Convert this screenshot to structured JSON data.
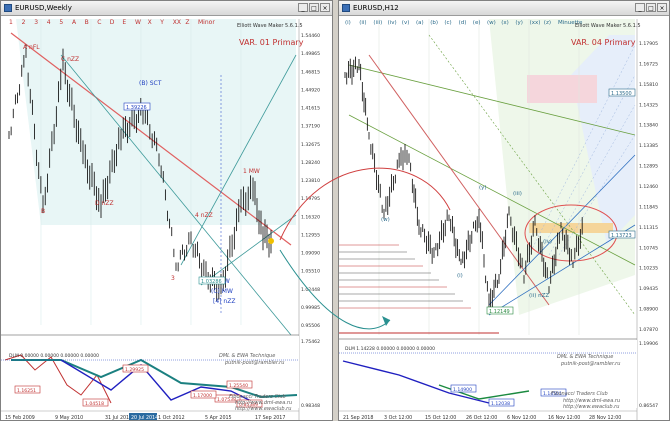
{
  "left_window": {
    "title": "EURUSD,Weekly",
    "indicator_name": "Elliott Wave Maker 5.6.1.5",
    "variant": "VAR. 01 Primary",
    "top_labels": [
      "1",
      "2",
      "3",
      "4",
      "5",
      "A",
      "B",
      "C",
      "D",
      "E",
      "W",
      "X",
      "Y",
      "XX",
      "Z",
      "Minor"
    ],
    "price_scale": [
      "1.54460",
      "1.49865",
      "1.46815",
      "1.44920",
      "1.41615",
      "1.37190",
      "1.32675",
      "1.28240",
      "1.23810",
      "1.19795",
      "1.16320",
      "1.12955",
      "1.09090",
      "1.05510",
      "1.02448",
      "0.99985",
      "0.95506"
    ],
    "osc_scale": [
      "1.75462",
      "0.98348"
    ],
    "price_boxes": [
      "1.39226",
      "1.03286"
    ],
    "osc_boxes": [
      "1.29925",
      "1.25540",
      "1.16251",
      "1.04518",
      "1.07538",
      "0.85389",
      "1.17000"
    ],
    "wave_labels": [
      "A nFL",
      "C nZZ",
      "(B) SCT",
      "1 MW",
      "B",
      "D nZZ",
      "4 nZZ",
      "3",
      "5 MW",
      "(C) MW",
      "[4] nZZ",
      "4",
      "5"
    ],
    "date_axis": [
      "15 Feb 2009",
      "9 May 2010",
      "31 Jul 2011",
      "21 Oct 2012",
      "5 Apr 2015",
      "17 Sep 2017"
    ],
    "date_box": "20 Jul 2014",
    "watermark": [
      "DML & EWA Technique",
      "putnik-post@rambler.ru",
      "Fibonacci Traders Club",
      "http://www.dml-ewa.ru",
      "http://www.ewaclub.ru"
    ]
  },
  "right_window": {
    "title": "EURUSD,H12",
    "indicator_name": "Elliott Wave Maker 5.6.1.5",
    "variant": "VAR. 04 Primary",
    "top_labels": [
      "(i)",
      "(ii)",
      "(iii)",
      "(iv)",
      "(v)",
      "(a)",
      "(b)",
      "(c)",
      "(d)",
      "(e)",
      "(w)",
      "(x)",
      "(y)",
      "(xx)",
      "(z)",
      "Minuette"
    ],
    "price_scale": [
      "1.17905",
      "1.16725",
      "1.15810",
      "1.14325",
      "1.13840",
      "1.13385",
      "1.12895",
      "1.12460",
      "1.11845",
      "1.11315",
      "1.10745",
      "1.10235",
      "1.09435",
      "1.08900",
      "1.07870"
    ],
    "price_boxes": [
      "1.13723",
      "1.13500",
      "1.12149"
    ],
    "osc_scale": [
      "1.19906",
      "0.86547"
    ],
    "osc_boxes": [
      "1.14900",
      "1.14501",
      "1.12038"
    ],
    "wave_labels": [
      "(w)",
      "(y)",
      "(i)",
      "(ii) nZZ",
      "(iv)",
      "(iii)"
    ],
    "date_axis": [
      "21 Sep 2018",
      "3 Oct 12:00",
      "15 Oct 12:00",
      "26 Oct 12:00",
      "6 Nov 12:00",
      "16 Nov 12:00",
      "28 Nov 12:00"
    ],
    "watermark": [
      "DML & EWA Technique",
      "putnik-post@rambler.ru",
      "Fibonacci Traders Club",
      "http://www.dml-ewa.ru",
      "http://www.ewaclub.ru"
    ]
  }
}
